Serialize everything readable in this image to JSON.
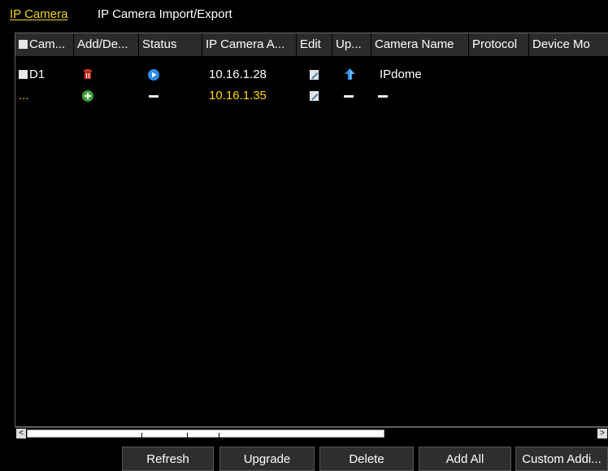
{
  "tabs": [
    {
      "label": "IP Camera",
      "active": true
    },
    {
      "label": "IP Camera Import/Export",
      "active": false
    }
  ],
  "table": {
    "headers": [
      "Cam...",
      "Add/De...",
      "Status",
      "IP Camera A...",
      "Edit",
      "Up...",
      "Camera Name",
      "Protocol",
      "Device Mo"
    ],
    "rows": [
      {
        "camera": "D1",
        "ip": "10.16.1.28",
        "camera_name": "IPdome",
        "protocol": "",
        "device_model": ""
      },
      {
        "camera": "...",
        "ip": "10.16.1.35",
        "camera_name": "",
        "protocol": "",
        "device_model": ""
      }
    ]
  },
  "scrollbar": {
    "left_arrow": "<",
    "right_arrow": ">"
  },
  "buttons": {
    "refresh": "Refresh",
    "upgrade": "Upgrade",
    "delete": "Delete",
    "add_all": "Add All",
    "custom_add": "Custom Addi..."
  },
  "colors": {
    "accent": "#f2d21a",
    "highlight_row_text": "#ffd700",
    "header_bg": "#2b2b2b",
    "background": "#000000",
    "button_bg": "#2e2e2e"
  },
  "icons": [
    "trash-icon",
    "play-icon",
    "plus-icon",
    "edit-icon",
    "upgrade-arrow-icon",
    "checkbox-icon"
  ]
}
